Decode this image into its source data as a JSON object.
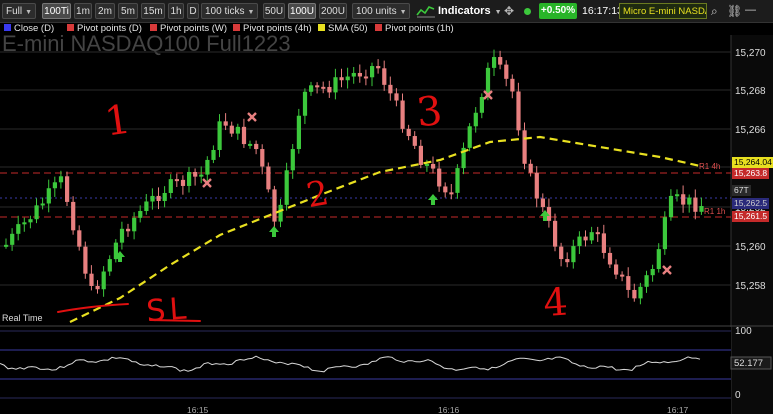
{
  "toolbar": {
    "mode": "Full",
    "bar_types": [
      "100Ti",
      "1m",
      "2m",
      "5m",
      "15m",
      "1h",
      "D"
    ],
    "selected_bar_type": "100Ti",
    "ticks": "100 ticks",
    "unit_buttons": [
      "50U",
      "100U",
      "200U"
    ],
    "selected_unit": "100U",
    "units": "100 units",
    "indicators": "Indicators",
    "change": "+0.50%",
    "time": "16:17:13",
    "instrument": "Micro E-mini NASDA"
  },
  "legend": [
    {
      "label": "Close (D)",
      "color": "#3a3af0"
    },
    {
      "label": "Pivot points (D)",
      "color": "#d83a3a"
    },
    {
      "label": "Pivot points (W)",
      "color": "#d83a3a"
    },
    {
      "label": "Pivot points (4h)",
      "color": "#d83a3a"
    },
    {
      "label": "SMA (50)",
      "color": "#e8e020"
    },
    {
      "label": "Pivot points (1h)",
      "color": "#d83a3a"
    }
  ],
  "chart": {
    "watermark": "E-mini NASDAQ100 Full1223",
    "price_ticks": [
      "15,270",
      "15,268",
      "15,266",
      "15,264",
      "15,262",
      "15,260",
      "15,258"
    ],
    "price_tags": [
      {
        "text": "15,264.04",
        "color": "#e8e020",
        "fg": "#000"
      },
      {
        "text": "15,263.8",
        "color": "#c42a2a",
        "fg": "#fff"
      },
      {
        "text": "67T",
        "color": "#2a2a2a",
        "fg": "#ddd"
      },
      {
        "text": "15,262.5",
        "color": "#2a2a7a",
        "fg": "#ccc"
      },
      {
        "text": "15,261.5",
        "color": "#c42a2a",
        "fg": "#fff"
      }
    ],
    "level_labels": [
      "R1 4h",
      "R1 1h"
    ],
    "status": "Real Time",
    "time_labels": [
      "16:15",
      "16:16",
      "16:17"
    ],
    "annotations": [
      "1",
      "2",
      "3",
      "4",
      "SL"
    ]
  },
  "oscillator": {
    "ticks": [
      "100",
      "0"
    ],
    "value": "52.177"
  },
  "colors": {
    "up": "#3cc83c",
    "down": "#e88080",
    "sma": "#e8e020",
    "pivot_red": "#c42a2a",
    "pivot_blue": "#3a3af0",
    "annotation": "#e01010"
  }
}
